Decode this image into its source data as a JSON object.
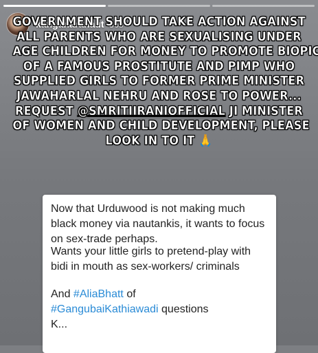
{
  "story": {
    "progress_segments": 3,
    "active_segment": 1,
    "user": {
      "username": "kanganaranaut",
      "time": "36s"
    },
    "headline_lines": [
      "GOVERNMENT SHOULD TAKE ACTION AGAINST",
      "ALL PARENTS WHO ARE SEXUALISING UNDER",
      "AGE CHILDREN FOR MONEY TO PROMOTE BIOPIC",
      "OF A FAMOUS PROSTITUTE AND PIMP WHO",
      "SUPPLIED GIRLS TO FORMER PRIME MINISTER",
      "JAWAHARLAL NEHRU AND ROSE TO POWER...",
      "JI MINISTER",
      "OF WOMEN AND CHILD DEVELOPMENT, PLEASE",
      "LOOK IN TO IT"
    ],
    "headline_request": "REQUEST",
    "headline_mention": "@SMRITIIRANIOFFICIAL",
    "headline_emoji": "🙏"
  },
  "tweet_card": {
    "paragraph_1": "Now that Urduwood is not making much black money via nautankis, it wants to focus on sex-trade perhaps.",
    "paragraph_2": "Wants your little girls to pretend-play with bidi in mouth as sex-workers/ criminals",
    "paragraph_3_prefix": "And",
    "hashtag_1": "#AliaBhatt",
    "paragraph_3_mid": "of",
    "hashtag_2": "#GangubaiKathiawadi",
    "paragraph_3_suffix": "questions",
    "paragraph_3_tail": "K..."
  }
}
